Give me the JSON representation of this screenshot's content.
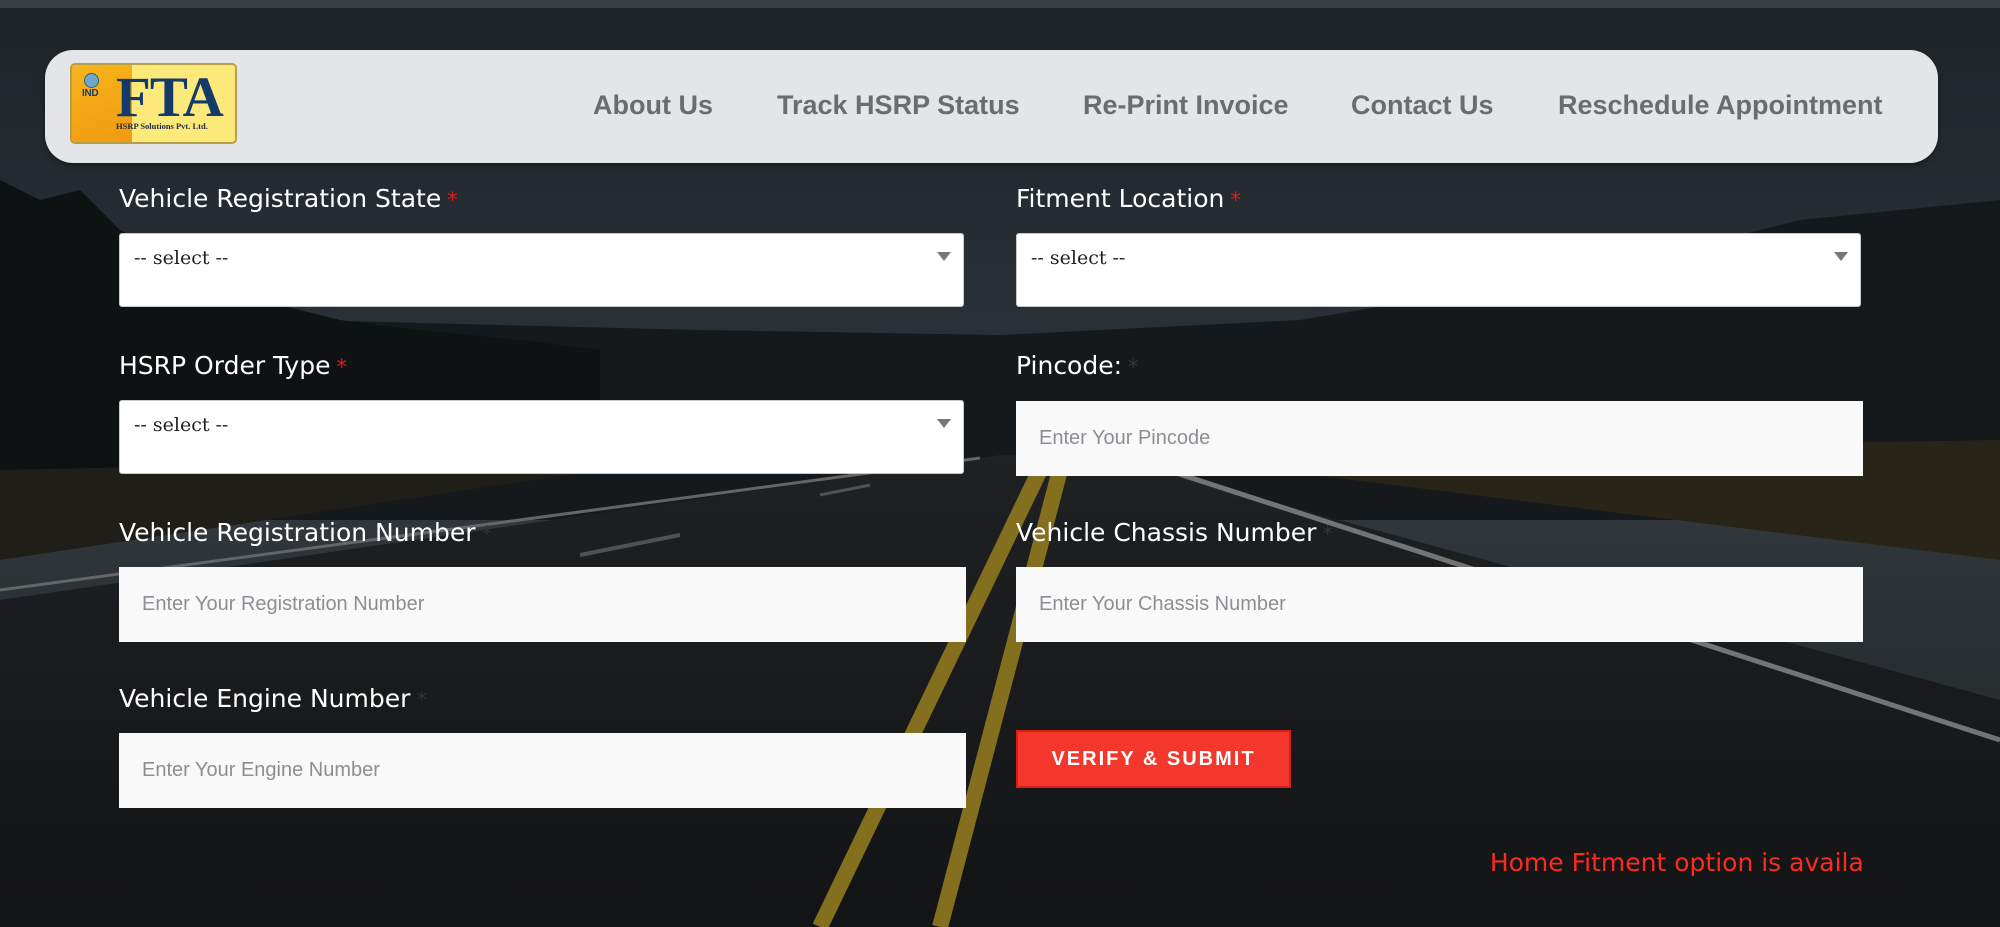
{
  "brand": {
    "logo_text": "FTA",
    "logo_badge": "IND",
    "logo_subtitle": "HSRP Solutions Pvt. Ltd."
  },
  "nav": {
    "items": [
      {
        "label": "About Us"
      },
      {
        "label": "Track HSRP Status"
      },
      {
        "label": "Re-Print Invoice"
      },
      {
        "label": "Contact Us"
      },
      {
        "label": "Reschedule Appointment"
      }
    ]
  },
  "form": {
    "vehicle_registration_state": {
      "label": "Vehicle Registration State",
      "required_mark": "*",
      "selected": "-- select --"
    },
    "fitment_location": {
      "label": "Fitment Location",
      "required_mark": "*",
      "selected": "-- select --"
    },
    "hsrp_order_type": {
      "label": "HSRP Order Type",
      "required_mark": "*",
      "selected": "-- select --"
    },
    "pincode": {
      "label": "Pincode:",
      "required_mark": "*",
      "value": "",
      "placeholder": "Enter Your Pincode"
    },
    "registration_number": {
      "label": "Vehicle Registration Number",
      "required_mark": "*",
      "value": "",
      "placeholder": "Enter Your Registration Number"
    },
    "chassis_number": {
      "label": "Vehicle Chassis Number",
      "required_mark": "*",
      "value": "",
      "placeholder": "Enter Your Chassis Number"
    },
    "engine_number": {
      "label": "Vehicle Engine Number",
      "required_mark": "*",
      "value": "",
      "placeholder": "Enter Your Engine Number"
    },
    "submit_label": "VERIFY & SUBMIT"
  },
  "notice": {
    "text": "Home Fitment option is available"
  },
  "colors": {
    "accent_red": "#f3372c",
    "required_red": "#e01b1b",
    "nav_text": "#6a6c70",
    "header_bg": "#ebedee"
  }
}
